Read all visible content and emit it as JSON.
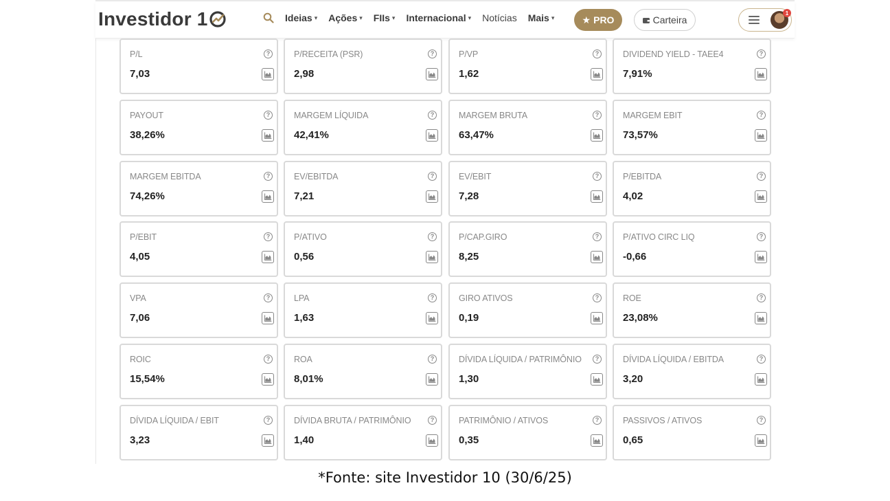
{
  "header": {
    "logo_text": "Investidor 1",
    "nav": [
      {
        "label": "Ideias",
        "caret": true
      },
      {
        "label": "Ações",
        "caret": true
      },
      {
        "label": "FIIs",
        "caret": true
      },
      {
        "label": "Internacional",
        "caret": true
      },
      {
        "label": "Notícias",
        "caret": false
      },
      {
        "label": "Mais",
        "caret": true
      }
    ],
    "pro_label": "PRO",
    "carteira_label": "Carteira",
    "notification_count": "1",
    "accent_color": "#a68b5b"
  },
  "indicators": [
    {
      "label": "P/L",
      "value": "7,03"
    },
    {
      "label": "P/RECEITA (PSR)",
      "value": "2,98"
    },
    {
      "label": "P/VP",
      "value": "1,62"
    },
    {
      "label": "DIVIDEND YIELD - TAEE4",
      "value": "7,91%"
    },
    {
      "label": "PAYOUT",
      "value": "38,26%"
    },
    {
      "label": "MARGEM LÍQUIDA",
      "value": "42,41%"
    },
    {
      "label": "MARGEM BRUTA",
      "value": "63,47%"
    },
    {
      "label": "MARGEM EBIT",
      "value": "73,57%"
    },
    {
      "label": "MARGEM EBITDA",
      "value": "74,26%"
    },
    {
      "label": "EV/EBITDA",
      "value": "7,21"
    },
    {
      "label": "EV/EBIT",
      "value": "7,28"
    },
    {
      "label": "P/EBITDA",
      "value": "4,02"
    },
    {
      "label": "P/EBIT",
      "value": "4,05"
    },
    {
      "label": "P/ATIVO",
      "value": "0,56"
    },
    {
      "label": "P/CAP.GIRO",
      "value": "8,25"
    },
    {
      "label": "P/ATIVO CIRC LIQ",
      "value": "-0,66"
    },
    {
      "label": "VPA",
      "value": "7,06"
    },
    {
      "label": "LPA",
      "value": "1,63"
    },
    {
      "label": "GIRO ATIVOS",
      "value": "0,19"
    },
    {
      "label": "ROE",
      "value": "23,08%"
    },
    {
      "label": "ROIC",
      "value": "15,54%"
    },
    {
      "label": "ROA",
      "value": "8,01%"
    },
    {
      "label": "DÍVIDA LÍQUIDA / PATRIMÔNIO",
      "value": "1,30"
    },
    {
      "label": "DÍVIDA LÍQUIDA / EBITDA",
      "value": "3,20"
    },
    {
      "label": "DÍVIDA LÍQUIDA / EBIT",
      "value": "3,23"
    },
    {
      "label": "DÍVIDA BRUTA / PATRIMÔNIO",
      "value": "1,40"
    },
    {
      "label": "PATRIMÔNIO / ATIVOS",
      "value": "0,35"
    },
    {
      "label": "PASSIVOS / ATIVOS",
      "value": "0,65"
    }
  ],
  "icons": {
    "help": "question-circle-icon",
    "chart": "area-chart-icon"
  },
  "caption": "*Fonte: site Investidor 10 (30/6/25)"
}
